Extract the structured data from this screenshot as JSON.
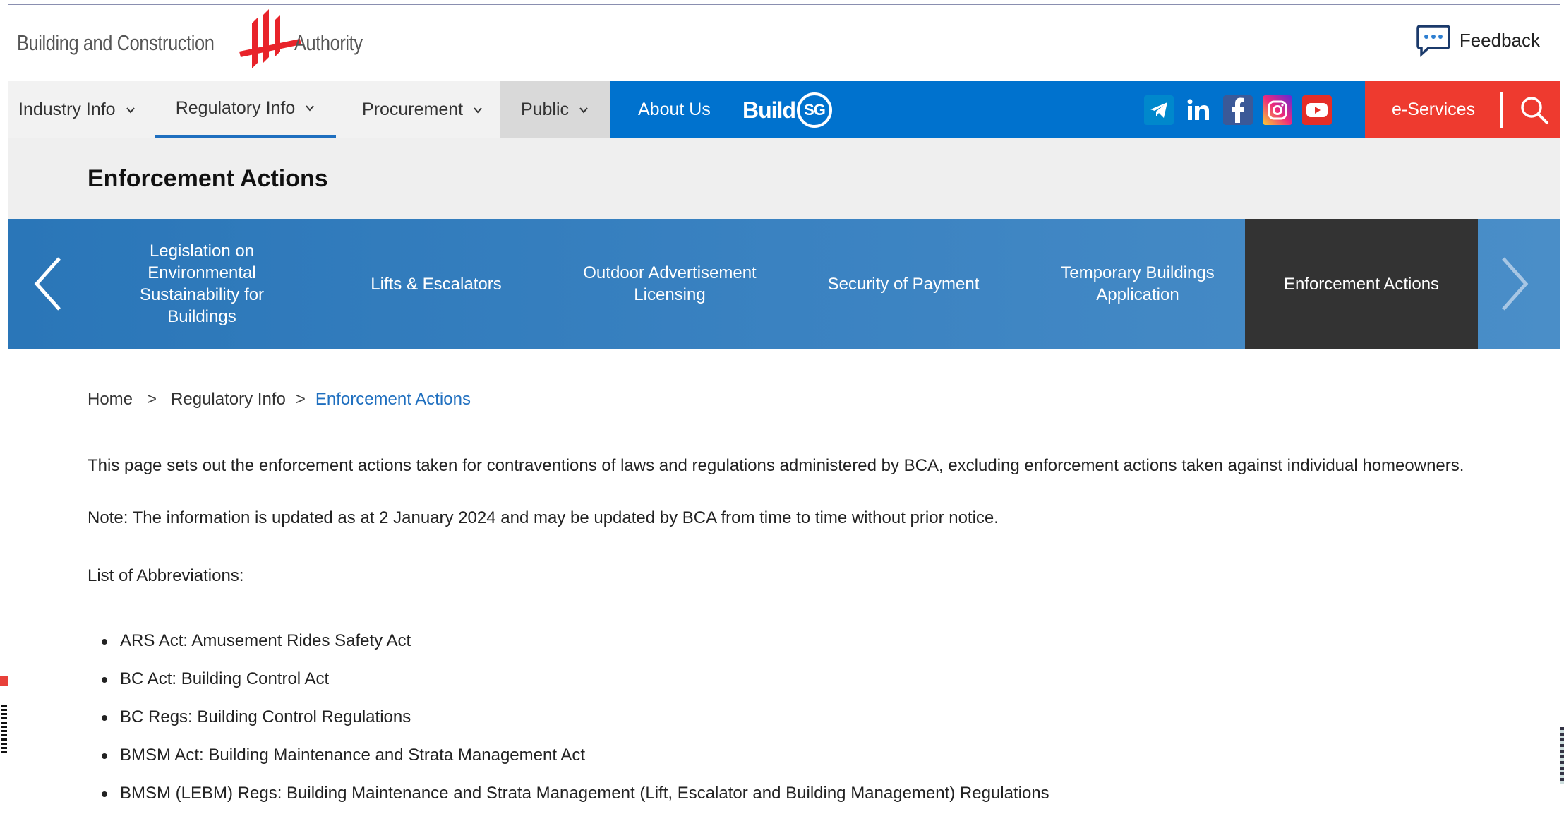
{
  "header": {
    "logo_left": "Building and Construction",
    "logo_right": "Authority",
    "feedback_label": "Feedback"
  },
  "nav": {
    "items": [
      {
        "label": "Industry Info"
      },
      {
        "label": "Regulatory Info"
      },
      {
        "label": "Procurement"
      },
      {
        "label": "Public"
      }
    ],
    "about_label": "About Us",
    "buildsg_build": "Build",
    "buildsg_sg": "SG",
    "eservices_label": "e-Services"
  },
  "social": [
    {
      "icon": "telegram-icon",
      "color": "#0088cc"
    },
    {
      "icon": "linkedin-icon",
      "color": "#0072ce"
    },
    {
      "icon": "facebook-icon",
      "color": "#3b5998"
    },
    {
      "icon": "instagram-icon",
      "color": "#d6249f"
    },
    {
      "icon": "youtube-icon",
      "color": "#e52d27"
    }
  ],
  "page_title": "Enforcement Actions",
  "carousel": {
    "items": [
      {
        "label": "Legislation on Environmental Sustainability for Buildings",
        "active": false
      },
      {
        "label": "Lifts & Escalators",
        "active": false
      },
      {
        "label": "Outdoor Advertisement Licensing",
        "active": false
      },
      {
        "label": "Security of Payment",
        "active": false
      },
      {
        "label": "Temporary Buildings Application",
        "active": false
      },
      {
        "label": "Enforcement Actions",
        "active": true
      }
    ]
  },
  "breadcrumb": {
    "home": "Home",
    "sep": ">",
    "parent": "Regulatory Info",
    "current": "Enforcement Actions"
  },
  "content": {
    "intro": "This page sets out the enforcement actions taken for contraventions of laws and regulations administered by BCA, excluding enforcement actions taken against individual homeowners.",
    "note": "Note: The information is updated as at 2 January 2024 and may be updated by BCA from time to time without prior notice.",
    "abbr_heading": "List of Abbreviations:",
    "abbreviations": [
      "ARS Act: Amusement Rides Safety Act",
      "BC Act: Building Control Act",
      "BC Regs: Building Control Regulations",
      "BMSM Act: Building Maintenance and Strata Management Act",
      "BMSM (LEBM) Regs: Building Maintenance and Strata Management (Lift, Escalator and Building Management) Regulations"
    ]
  },
  "colors": {
    "nav_blue": "#0072ce",
    "eservices_red": "#ee3a2f",
    "link_blue": "#1f6fbf",
    "active_tab": "#333333"
  }
}
